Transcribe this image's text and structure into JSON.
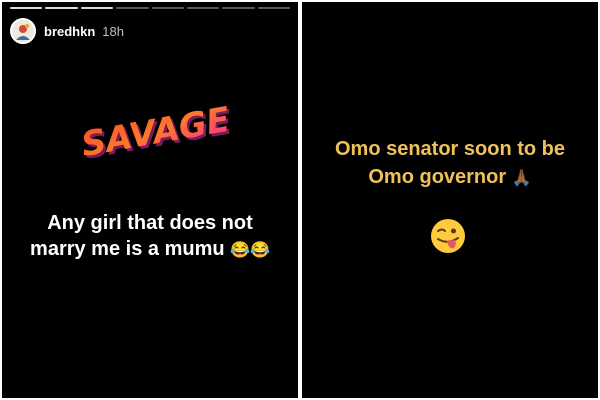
{
  "left_story": {
    "username": "bredhkn",
    "time": "18h",
    "sticker_text": "SAVAGE",
    "caption_line1": "Any girl that does not",
    "caption_line2": "marry me is a mumu",
    "caption_emoji": "😂😂",
    "avatar_icon": "profile-avatar",
    "progress_segments": 8,
    "progress_completed": 3
  },
  "right_story": {
    "line1": "Omo senator soon to be",
    "line2": "Omo governor",
    "pray_emoji": "🙏🏾",
    "emoji": "winking-tongue-face",
    "text_color": "#f0c15a"
  }
}
